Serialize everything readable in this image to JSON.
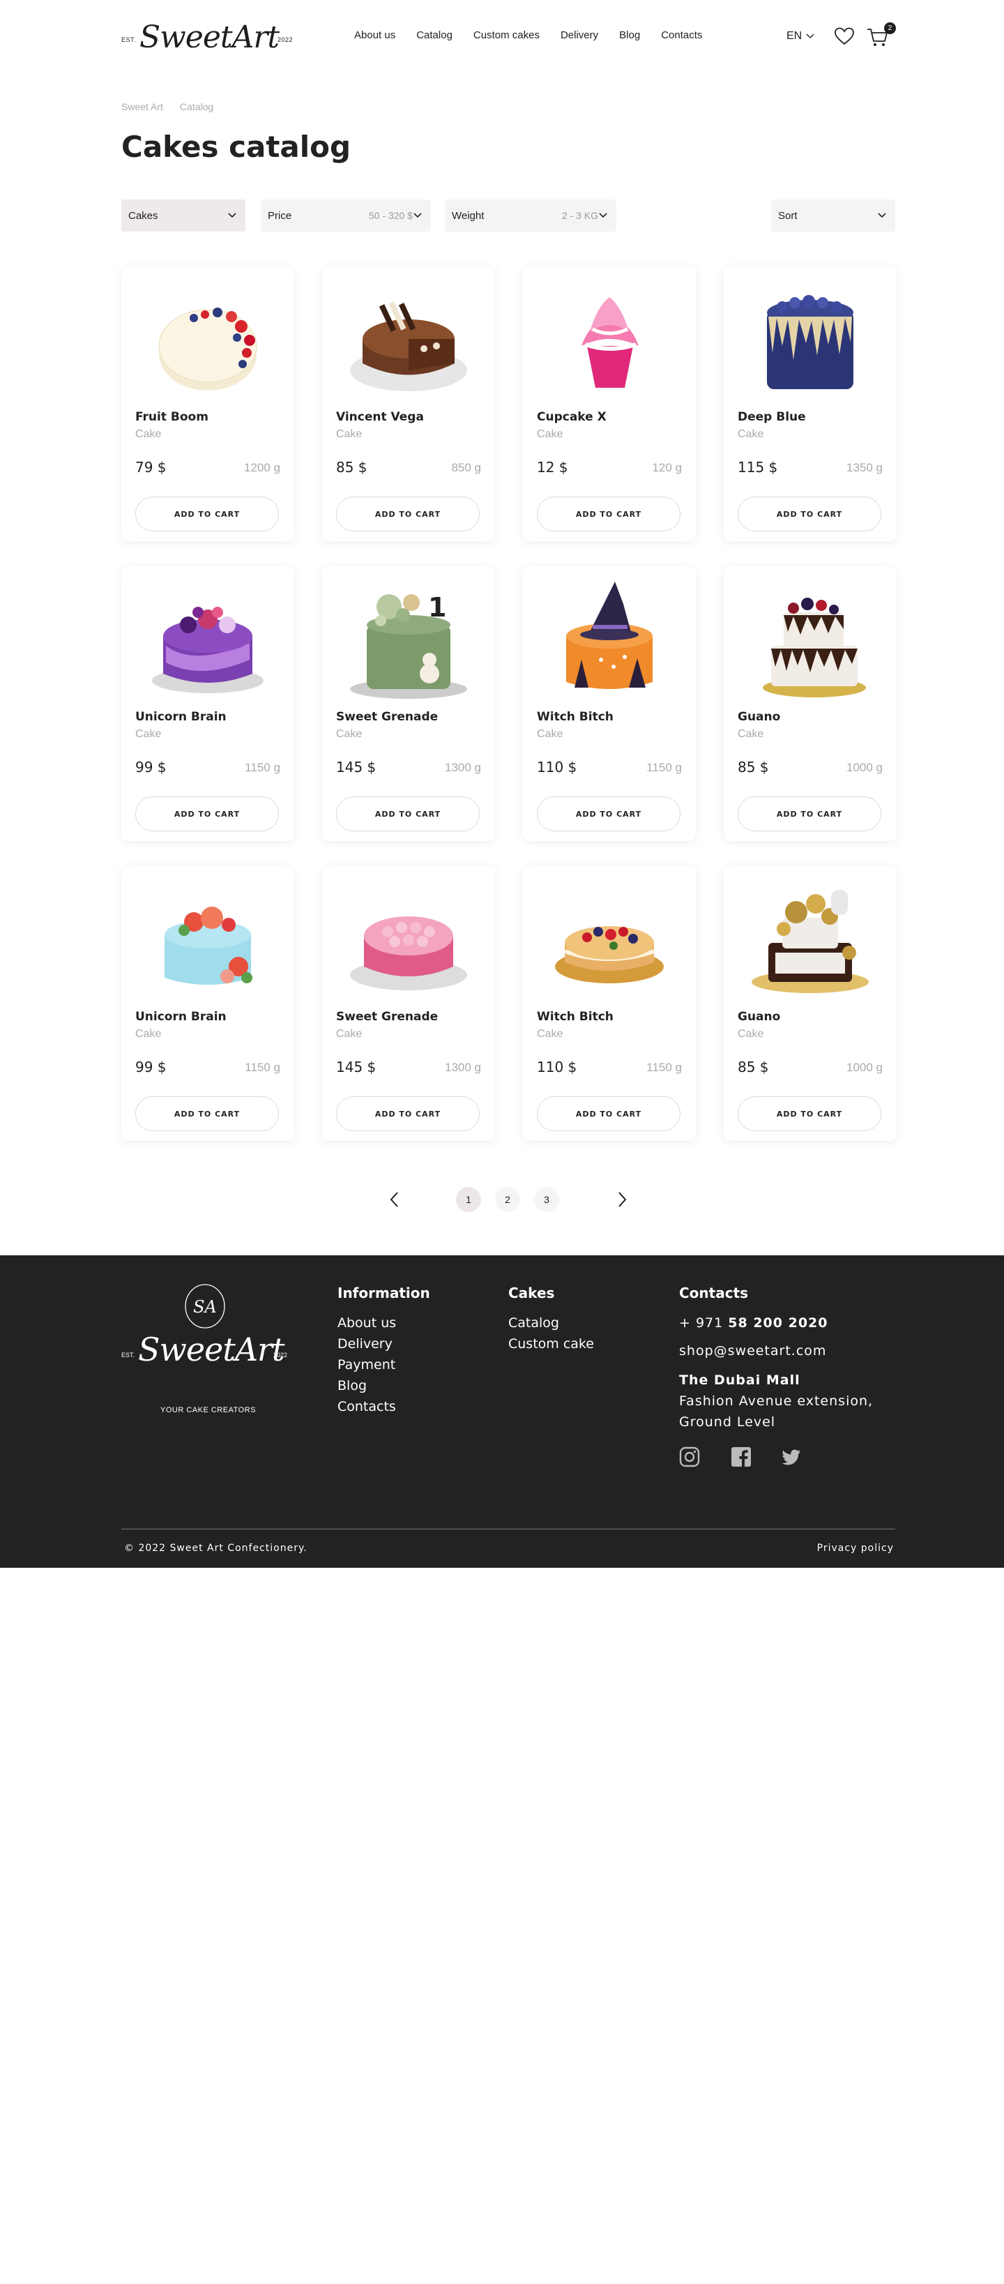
{
  "header": {
    "logo": {
      "brand": "SweetArt",
      "est": "EST.",
      "year": "2022"
    },
    "nav": [
      "About us",
      "Catalog",
      "Custom cakes",
      "Delivery",
      "Blog",
      "Contacts"
    ],
    "language": "EN",
    "cart_count": "2"
  },
  "breadcrumb": [
    "Sweet Art",
    "Catalog"
  ],
  "page_title": "Cakes catalog",
  "filters": {
    "category": {
      "label": "Cakes"
    },
    "price": {
      "label": "Price",
      "value": "50 - 320 $"
    },
    "weight": {
      "label": "Weight",
      "value": "2 - 3 KG"
    },
    "sort": {
      "label": "Sort"
    }
  },
  "button_label": "ADD TO CART",
  "products": [
    {
      "name": "Fruit Boom",
      "type": "Cake",
      "price": "79 $",
      "weight": "1200 g",
      "image": "cream-cake-with-berries"
    },
    {
      "name": "Vincent Vega",
      "type": "Cake",
      "price": "85 $",
      "weight": "850 g",
      "image": "chocolate-cake-sliced"
    },
    {
      "name": "Cupcake X",
      "type": "Cake",
      "price": "12 $",
      "weight": "120 g",
      "image": "pink-cupcake"
    },
    {
      "name": "Deep Blue",
      "type": "Cake",
      "price": "115 $",
      "weight": "1350 g",
      "image": "blue-drip-cake"
    },
    {
      "name": "Unicorn Brain",
      "type": "Cake",
      "price": "99 $",
      "weight": "1150 g",
      "image": "purple-unicorn-cake"
    },
    {
      "name": "Sweet Grenade",
      "type": "Cake",
      "price": "145 $",
      "weight": "1300 g",
      "image": "green-birthday-cake"
    },
    {
      "name": "Witch Bitch",
      "type": "Cake",
      "price": "110 $",
      "weight": "1150 g",
      "image": "witch-hat-cake"
    },
    {
      "name": "Guano",
      "type": "Cake",
      "price": "85 $",
      "weight": "1000 g",
      "image": "chocolate-berry-cake"
    },
    {
      "name": "Unicorn Brain",
      "type": "Cake",
      "price": "99 $",
      "weight": "1150 g",
      "image": "light-blue-flower-cake"
    },
    {
      "name": "Sweet Grenade",
      "type": "Cake",
      "price": "145 $",
      "weight": "1300 g",
      "image": "pink-rose-cake"
    },
    {
      "name": "Witch Bitch",
      "type": "Cake",
      "price": "110 $",
      "weight": "1150 g",
      "image": "naked-berry-cake"
    },
    {
      "name": "Guano",
      "type": "Cake",
      "price": "85 $",
      "weight": "1000 g",
      "image": "gold-balls-cake"
    }
  ],
  "pagination": {
    "pages": [
      "1",
      "2",
      "3"
    ],
    "current": "1"
  },
  "footer": {
    "logo": {
      "brand": "SweetArt",
      "est": "EST.",
      "year": "2022",
      "tagline": "YOUR CAKE CREATORS",
      "monogram": "SA"
    },
    "information": {
      "title": "Information",
      "links": [
        "About us",
        "Delivery",
        "Payment",
        "Blog",
        "Contacts"
      ]
    },
    "cakes": {
      "title": "Cakes",
      "links": [
        "Catalog",
        "Custom cake"
      ]
    },
    "contacts": {
      "title": "Contacts",
      "phone_prefix": "+ 971",
      "phone_number": "58 200 2020",
      "email": "shop@sweetart.com",
      "place": "The Dubai Mall",
      "address_line1": "Fashion Avenue extension,",
      "address_line2": "Ground Level"
    },
    "social": [
      "instagram-icon",
      "facebook-icon",
      "twitter-icon"
    ],
    "copyright": "© 2022 Sweet Art Confectionery.",
    "privacy": "Privacy policy"
  },
  "colors": {
    "dark": "#222222",
    "accent_pink": "#ede6e6",
    "muted": "#aaaaaa"
  }
}
